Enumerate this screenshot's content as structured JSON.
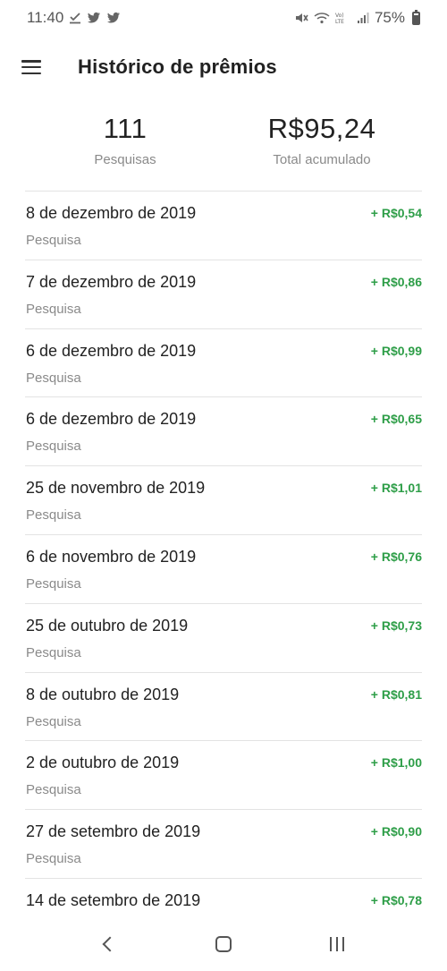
{
  "status_bar": {
    "time": "11:40",
    "battery": "75%",
    "icons": [
      "download-done-icon",
      "twitter-icon",
      "twitter-icon",
      "mute-icon",
      "wifi-icon",
      "volte-icon",
      "signal-icon",
      "battery-icon"
    ]
  },
  "app_bar": {
    "title": "Histórico de prêmios",
    "menu_icon": "menu-icon"
  },
  "summary": {
    "count": "111",
    "count_label": "Pesquisas",
    "total": "R$95,24",
    "total_label": "Total acumulado"
  },
  "rewards": [
    {
      "date": "8 de dezembro de 2019",
      "type": "Pesquisa",
      "amount": "+ R$0,54"
    },
    {
      "date": "7 de dezembro de 2019",
      "type": "Pesquisa",
      "amount": "+ R$0,86"
    },
    {
      "date": "6 de dezembro de 2019",
      "type": "Pesquisa",
      "amount": "+ R$0,99"
    },
    {
      "date": "6 de dezembro de 2019",
      "type": "Pesquisa",
      "amount": "+ R$0,65"
    },
    {
      "date": "25 de novembro de 2019",
      "type": "Pesquisa",
      "amount": "+ R$1,01"
    },
    {
      "date": "6 de novembro de 2019",
      "type": "Pesquisa",
      "amount": "+ R$0,76"
    },
    {
      "date": "25 de outubro de 2019",
      "type": "Pesquisa",
      "amount": "+ R$0,73"
    },
    {
      "date": "8 de outubro de 2019",
      "type": "Pesquisa",
      "amount": "+ R$0,81"
    },
    {
      "date": "2 de outubro de 2019",
      "type": "Pesquisa",
      "amount": "+ R$1,00"
    },
    {
      "date": "27 de setembro de 2019",
      "type": "Pesquisa",
      "amount": "+ R$0,90"
    },
    {
      "date": "14 de setembro de 2019",
      "type": "",
      "amount": "+ R$0,78"
    }
  ],
  "colors": {
    "amount_green": "#2e9e48",
    "secondary_text": "#8a8a8a",
    "divider": "#e3e3e3"
  },
  "nav_bar": {
    "icons": [
      "back-icon",
      "home-icon",
      "recent-apps-icon"
    ]
  }
}
